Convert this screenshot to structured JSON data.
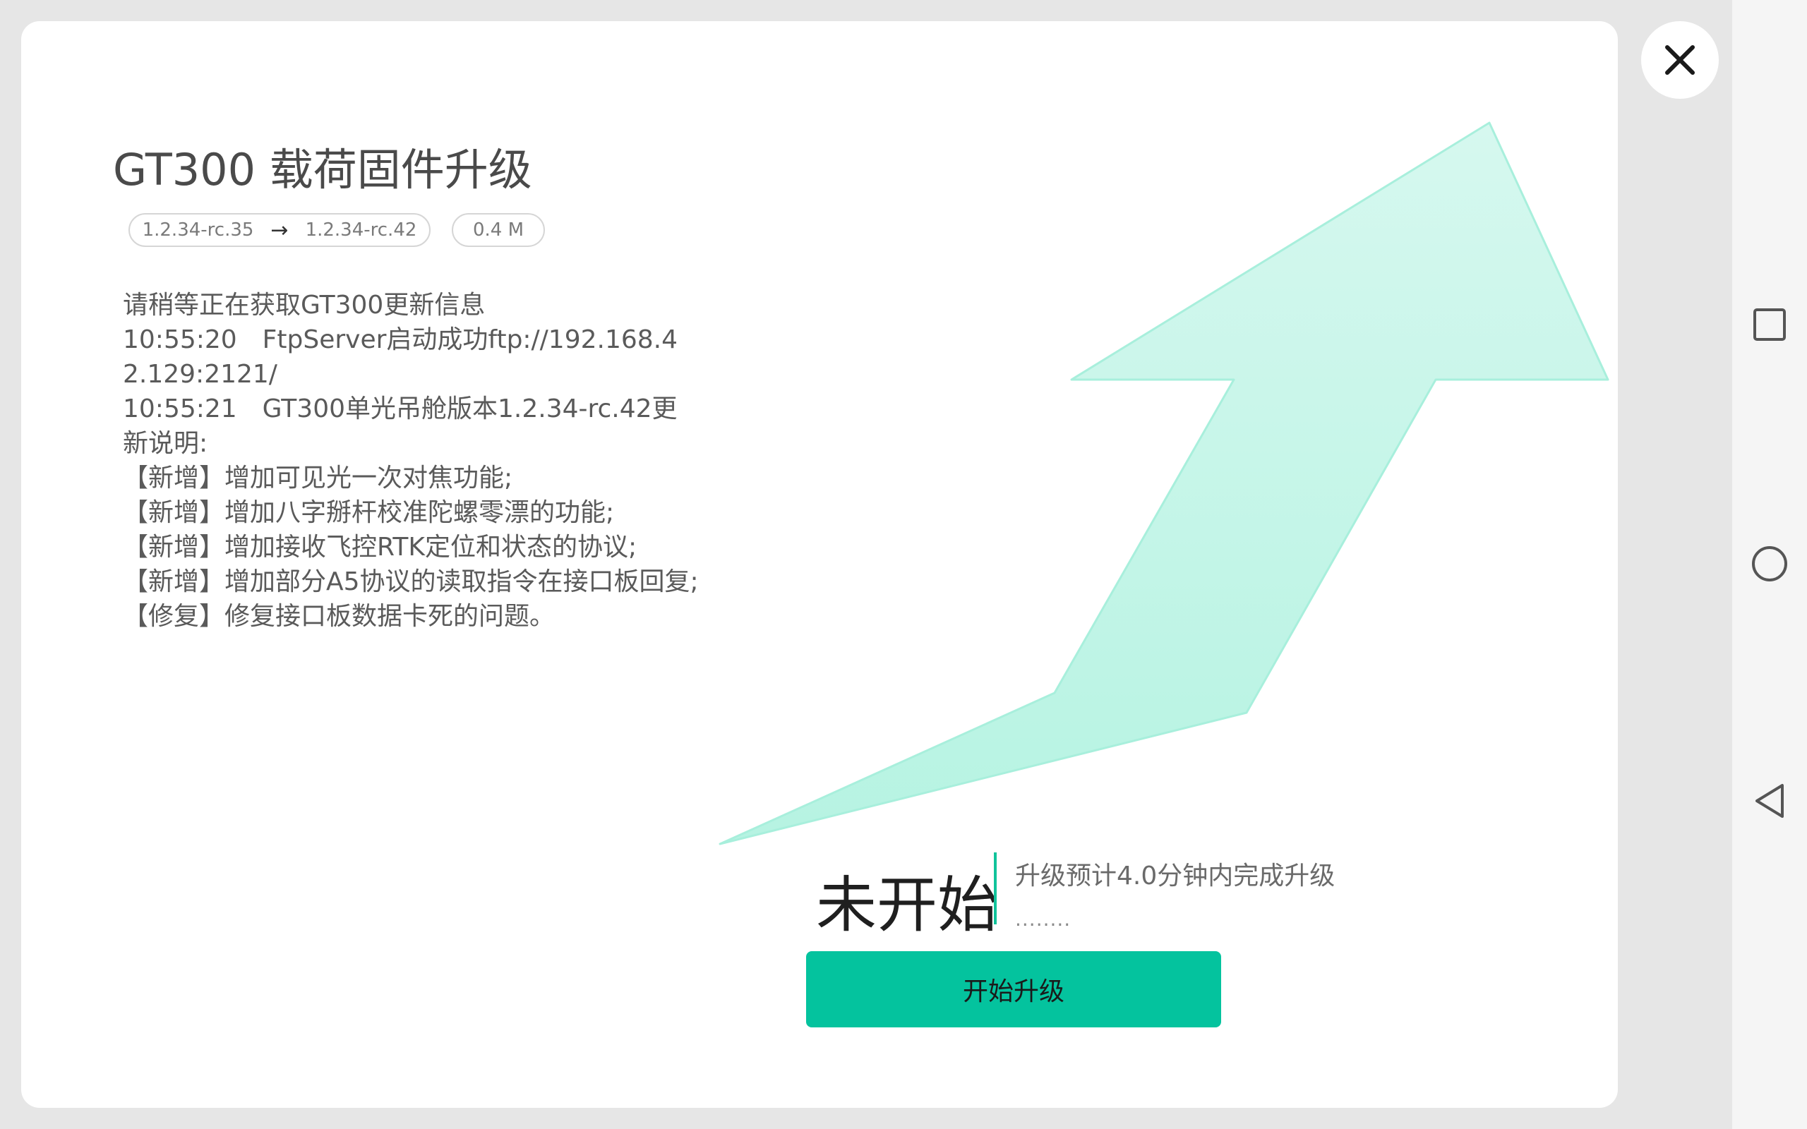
{
  "dialog": {
    "title": "GT300 载荷固件升级",
    "version_from": "1.2.34-rc.35",
    "version_arrow": "→",
    "version_to": "1.2.34-rc.42",
    "package_size": "0.4 M",
    "log_lines": [
      "请稍等正在获取GT300更新信息",
      "10:55:20　FtpServer启动成功ftp://192.168.42.129:2121/",
      "10:55:21　GT300单光吊舱版本1.2.34-rc.42更新说明:",
      "【新增】增加可见光一次对焦功能;",
      "【新增】增加八字掰杆校准陀螺零漂的功能;",
      "【新增】增加接收飞控RTK定位和状态的协议;",
      "【新增】增加部分A5协议的读取指令在接口板回复;",
      "【修复】修复接口板数据卡死的问题。"
    ],
    "status": "未开始",
    "status_note": "升级预计4.0分钟内完成升级",
    "status_dots": "........",
    "start_button": "开始升级"
  },
  "icons": {
    "close": "close-icon",
    "recents": "square-recents-icon",
    "home": "circle-home-icon",
    "back": "triangle-back-icon"
  },
  "colors": {
    "accent": "#04c39e",
    "arrow_fill": "#c4f7ea",
    "divider": "#10c39a"
  }
}
